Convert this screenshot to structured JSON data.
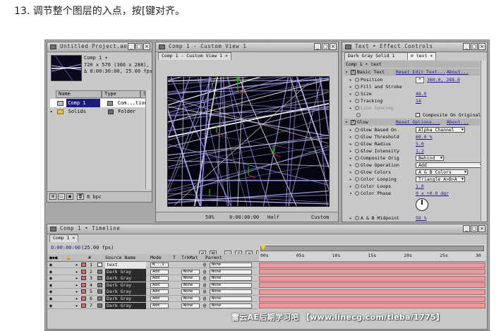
{
  "caption": "13. 调节整个图层的入点，按[键对齐。",
  "project": {
    "title": "Untitled Project.aep *",
    "comp_name": "Comp 1 ▾",
    "comp_info_line1": "720 x 576  (360 x 288), D",
    "comp_info_line2": "Δ 0:00:30:00, 25.00 fps",
    "col_name": "Name",
    "col_type": "Type",
    "col_size": "Si",
    "items": [
      {
        "name": "Comp 1",
        "type": "Com...tion",
        "swatch": "#8a8a8a"
      },
      {
        "name": "Solids",
        "type": "Folder",
        "swatch": "#6a6a6a"
      }
    ],
    "bpc": "8 bpc"
  },
  "viewer": {
    "title": "Comp 1 - Custom View 1",
    "tab_label": "Comp 1 - Custom View 1",
    "zoom": "50%",
    "timecode": "0:00:00:00",
    "quality": "Half",
    "view": "Custom"
  },
  "effects": {
    "title": "Text • Effect Controls",
    "layer_tab": "Dark Gray Solid 1",
    "text_tab": "text",
    "comp_header": "Comp 1 • text",
    "basic_text": "Basic Text",
    "reset_edit_text": "Reset Edit Text...",
    "about": "About...",
    "position_label": "Position",
    "position_value": "360.0, 288.0",
    "fill_stroke": "Fill and Stroke",
    "size_label": "Size",
    "size_value": "48.0",
    "tracking_label": "Tracking",
    "tracking_value": "14",
    "line_spacing_label": "Line Spacing",
    "composite_label": "Composite On Original",
    "glow": "Glow",
    "reset_options": "Reset Options...",
    "about2": "About...",
    "glow_based_on_label": "Glow Based On",
    "glow_based_on_value": "Alpha Channel",
    "glow_threshold_label": "Glow Threshold",
    "glow_threshold_value": "60.0 %",
    "glow_radius_label": "Glow Radius",
    "glow_radius_value": "5.0",
    "glow_intensity_label": "Glow Intensity",
    "glow_intensity_value": "1.2",
    "composite_orig_label": "Composite Orig",
    "composite_orig_value": "Behind",
    "glow_operation_label": "Glow Operation",
    "glow_operation_value": "Add",
    "glow_colors_label": "Glow Colors",
    "glow_colors_value": "A & B Colors",
    "color_looping_label": "Color Looping",
    "color_looping_value": "Triangle A>B>A",
    "color_loops_label": "Color Loops",
    "color_loops_value": "1.0",
    "color_phase_label": "Color Phase",
    "color_phase_value": "0 x +0.0 dgr",
    "ab_midpoint_label": "A & B Midpoint",
    "ab_midpoint_value": "50 %"
  },
  "timeline": {
    "title": "Comp 1 • Timeline",
    "tab": "Comp 1",
    "timecode": "0:00:00:00",
    "fps": "(25.00 fps)",
    "col_num": "#",
    "col_source": "Source Name",
    "col_mode": "Mode",
    "col_t": "T",
    "col_trkmat": "TrkMat",
    "col_parent": "Parent",
    "ruler": [
      "00s",
      "05s",
      "10s",
      "15s",
      "20s",
      "25s",
      "30"
    ],
    "layers": [
      {
        "num": "1",
        "name": "text",
        "mode": "N...1",
        "trkmat": "",
        "parent": "None",
        "label": "#d86b6b"
      },
      {
        "num": "2",
        "name": "Dark Gray",
        "mode": "Add",
        "trkmat": "None",
        "parent": "None",
        "label": "#d86b6b"
      },
      {
        "num": "3",
        "name": "Dark Gray",
        "mode": "Add",
        "trkmat": "None",
        "parent": "None",
        "label": "#d86b6b"
      },
      {
        "num": "4",
        "name": "Dark Gray",
        "mode": "Add",
        "trkmat": "None",
        "parent": "None",
        "label": "#d86b6b"
      },
      {
        "num": "5",
        "name": "Dark Gray",
        "mode": "Add",
        "trkmat": "None",
        "parent": "None",
        "label": "#d86b6b"
      },
      {
        "num": "6",
        "name": "Dark Gray",
        "mode": "Add",
        "trkmat": "None",
        "parent": "None",
        "label": "#d86b6b"
      },
      {
        "num": "7",
        "name": "Dark Gray",
        "mode": "Add",
        "trkmat": "None",
        "parent": "None",
        "label": "#d86b6b"
      }
    ]
  },
  "watermark": "雷云AE后期学习吧 【www.linecg.com/tieba/1775】",
  "colors": {
    "panel": "#c8c8c8",
    "layer_bar": "#e9999e",
    "link": "#1a1a8c"
  }
}
